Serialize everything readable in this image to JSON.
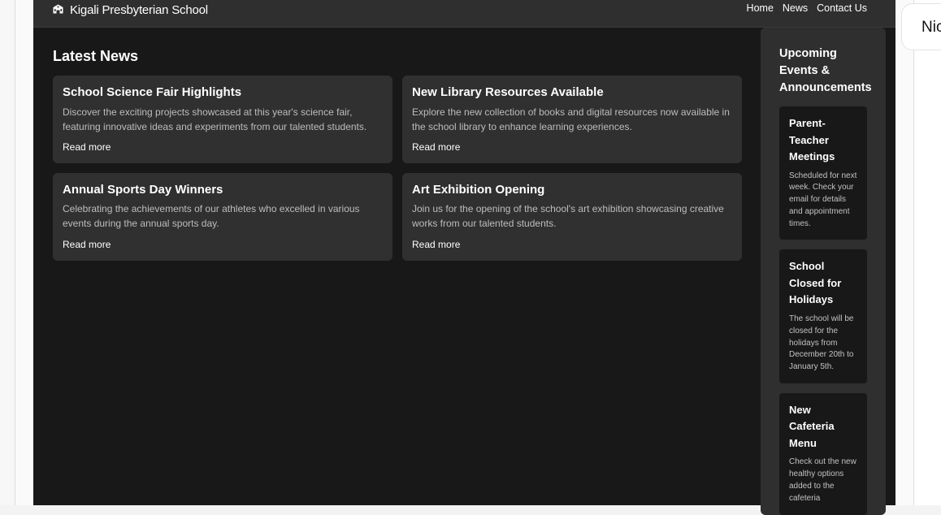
{
  "site": {
    "brand_icon": "school-building-icon",
    "brand_name": "Kigali Presbyterian School",
    "nav": [
      "Home",
      "News",
      "Contact Us"
    ]
  },
  "news": {
    "title": "Latest News",
    "cards": [
      {
        "title": "School Science Fair Highlights",
        "desc": "Discover the exciting projects showcased at this year's science fair, featuring innovative ideas and experiments from our talented students.",
        "link": "Read more"
      },
      {
        "title": "New Library Resources Available",
        "desc": "Explore the new collection of books and digital resources now available in the school library to enhance learning experiences.",
        "link": "Read more"
      },
      {
        "title": "Annual Sports Day Winners",
        "desc": "Celebrating the achievements of our athletes who excelled in various events during the annual sports day.",
        "link": "Read more"
      },
      {
        "title": "Art Exhibition Opening",
        "desc": "Join us for the opening of the school's art exhibition showcasing creative works from our talented students.",
        "link": "Read more"
      }
    ]
  },
  "sidebar": {
    "title": "Upcoming Events & Announcements",
    "events": [
      {
        "title": "Parent-Teacher Meetings",
        "desc": "Scheduled for next week. Check your email for details and appointment times."
      },
      {
        "title": "School Closed for Holidays",
        "desc": "The school will be closed for the holidays from December 20th to January 5th."
      },
      {
        "title": "New Cafeteria Menu",
        "desc": "Check out the new healthy options added to the cafeteria"
      }
    ]
  },
  "overlay_chip": {
    "text": "Nic"
  },
  "colors": {
    "page_bg": "#181818",
    "topbar_bg": "#2f2f2f",
    "card_bg": "#303030",
    "sidebar_bg": "#2f2f2f",
    "event_bg": "#181818",
    "text_primary": "#ffffff",
    "text_secondary": "#bdbdbd"
  }
}
